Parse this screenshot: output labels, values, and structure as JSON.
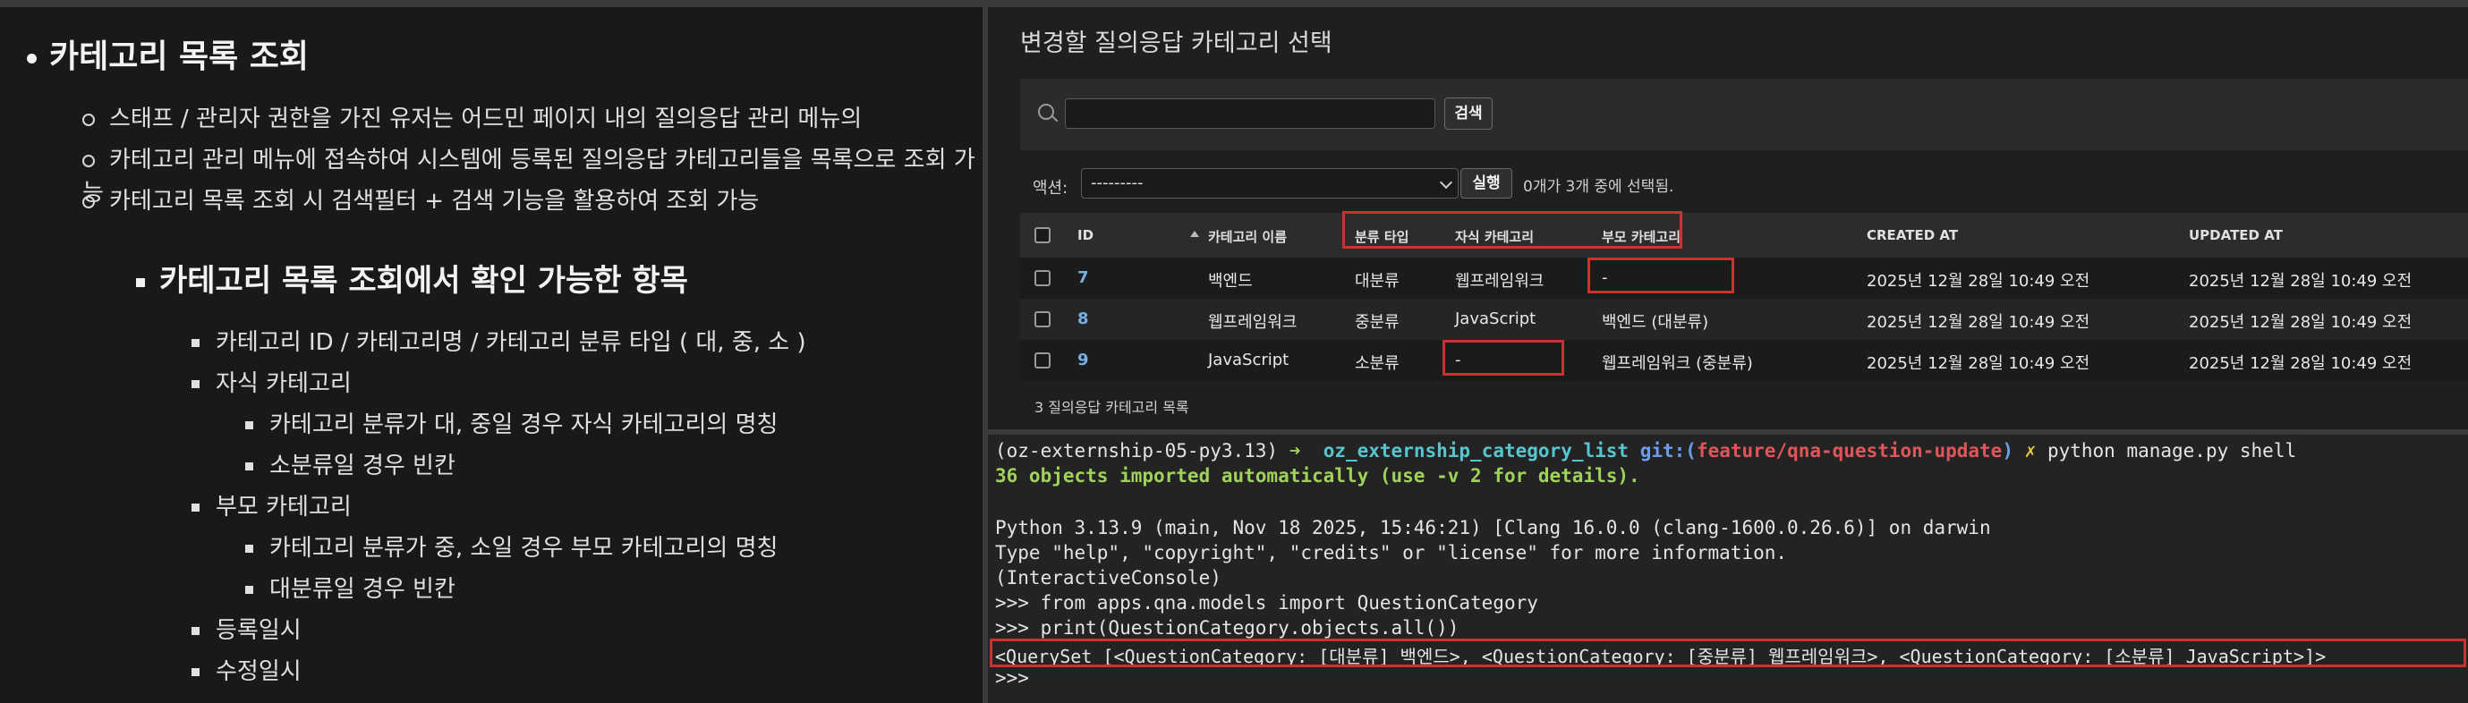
{
  "notes": {
    "heading": "카테고리 목록 조회",
    "points": [
      "스태프 / 관리자 권한을 가진 유저는 어드민 페이지 내의 질의응답 관리 메뉴의",
      "카테고리 관리 메뉴에 접속하여 시스템에 등록된 질의응답 카테고리들을 목록으로 조회 가능",
      "카테고리 목록 조회 시 검색필터 + 검색 기능을 활용하여 조회 가능"
    ],
    "subheading": "카테고리 목록 조회에서 확인 가능한 항목",
    "items": [
      "카테고리 ID / 카테고리명 / 카테고리 분류 타입 ( 대, 중, 소 )",
      "자식 카테고리",
      "카테고리 분류가 대, 중일 경우 자식 카테고리의 명칭",
      "소분류일 경우 빈칸",
      "부모 카테고리",
      "카테고리 분류가 중, 소일 경우 부모 카테고리의 명칭",
      "대분류일 경우 빈칸",
      "등록일시",
      "수정일시"
    ]
  },
  "admin": {
    "title": "변경할 질의응답 카테고리 선택",
    "search_button": "검색",
    "action_label": "액션:",
    "action_selected": "---------",
    "run_button": "실행",
    "selection_count": "0개가 3개 중에 선택됨.",
    "columns": [
      "ID",
      "카테고리 이름",
      "분류 타입",
      "자식 카테고리",
      "부모 카테고리",
      "CREATED AT",
      "UPDATED AT"
    ],
    "rows": [
      {
        "id": "7",
        "name": "백엔드",
        "type": "대분류",
        "child": "웹프레임워크",
        "parent": "-",
        "created": "2025년 12월 28일 10:49 오전",
        "updated": "2025년 12월 28일 10:49 오전"
      },
      {
        "id": "8",
        "name": "웹프레임워크",
        "type": "중분류",
        "child": "JavaScript",
        "parent": "백엔드 (대분류)",
        "created": "2025년 12월 28일 10:49 오전",
        "updated": "2025년 12월 28일 10:49 오전"
      },
      {
        "id": "9",
        "name": "JavaScript",
        "type": "소분류",
        "child": "-",
        "parent": "웹프레임워크 (중분류)",
        "created": "2025년 12월 28일 10:49 오전",
        "updated": "2025년 12월 28일 10:49 오전"
      }
    ],
    "footer": "3 질의응답 카테고리 목록"
  },
  "terminal": {
    "prompt_env": "(oz-externship-05-py3.13)",
    "arrow": "➜",
    "dir": "oz_externship_category_list",
    "git_label": "git:(",
    "branch": "feature/qna-question-update",
    "git_close": ")",
    "dirty": "✗",
    "command": "python manage.py shell",
    "imported": "36 objects imported automatically (use -v 2 for details).",
    "python_version": "Python 3.13.9 (main, Nov 18 2025, 15:46:21) [Clang 16.0.0 (clang-1600.0.26.6)] on darwin",
    "help_line": "Type \"help\", \"copyright\", \"credits\" or \"license\" for more information.",
    "console_line": "(InteractiveConsole)",
    "import_cmd": ">>> from apps.qna.models import QuestionCategory",
    "print_cmd": ">>> print(QuestionCategory.objects.all())",
    "queryset": "<QuerySet [<QuestionCategory: [대분류] 백엔드>, <QuestionCategory: [중분류] 웹프레임워크>, <QuestionCategory: [소분류] JavaScript>]>",
    "prompt": ">>>"
  },
  "colors": {
    "highlight": "#c8332f",
    "link": "#79aee0"
  }
}
